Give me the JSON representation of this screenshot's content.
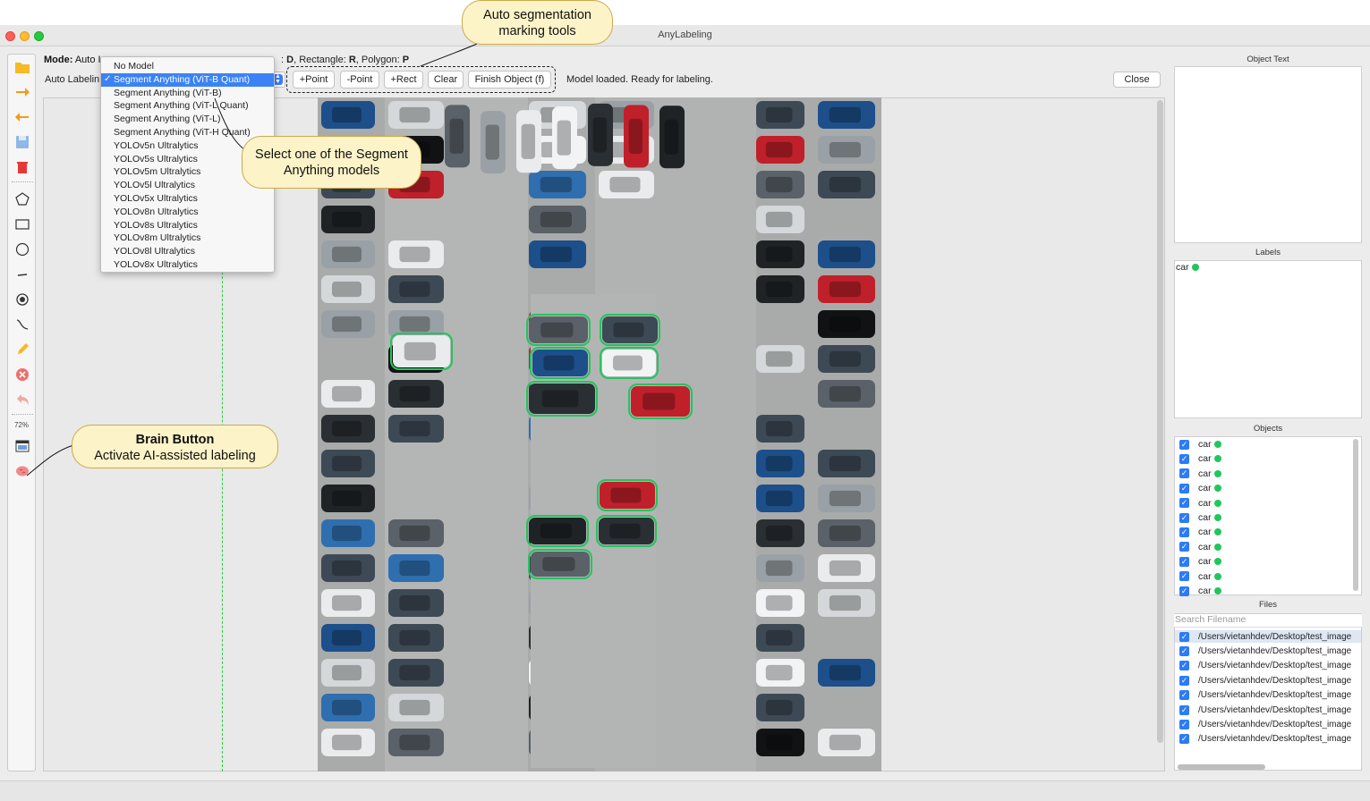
{
  "window": {
    "title": "AnyLabeling"
  },
  "mode": {
    "prefix": "Mode:",
    "value": "Auto I",
    "shortcut_d": "D",
    "rect_text": ", Rectangle: ",
    "shortcut_r": "R",
    "poly_text": ", Polygon: ",
    "shortcut_p": "P",
    "lead": ": "
  },
  "auto_labeling": {
    "label": "Auto Labelin"
  },
  "model_dropdown": {
    "items": [
      {
        "label": "No Model"
      },
      {
        "label": "Segment Anything (ViT-B Quant)",
        "selected": true
      },
      {
        "label": "Segment Anything (ViT-B)"
      },
      {
        "label": "Segment Anything (ViT-L Quant)"
      },
      {
        "label": "Segment Anything (ViT-L)"
      },
      {
        "label": "Segment Anything (ViT-H Quant)"
      },
      {
        "label": "YOLOv5n Ultralytics"
      },
      {
        "label": "YOLOv5s Ultralytics"
      },
      {
        "label": "YOLOv5m Ultralytics"
      },
      {
        "label": "YOLOv5l Ultralytics"
      },
      {
        "label": "YOLOv5x Ultralytics"
      },
      {
        "label": "YOLOv8n Ultralytics"
      },
      {
        "label": "YOLOv8s Ultralytics"
      },
      {
        "label": "YOLOv8m Ultralytics"
      },
      {
        "label": "YOLOv8l Ultralytics"
      },
      {
        "label": "YOLOv8x Ultralytics"
      }
    ],
    "check": "✓"
  },
  "seg_buttons": {
    "add_point": "+Point",
    "remove_point": "-Point",
    "add_rect": "+Rect",
    "clear": "Clear",
    "finish": "Finish Object (f)"
  },
  "status": "Model loaded. Ready for labeling.",
  "close_label": "Close",
  "zoom": "72%",
  "panels": {
    "object_text": "Object Text",
    "labels": "Labels",
    "objects": "Objects",
    "files": "Files",
    "search_placeholder": "Search Filename"
  },
  "labels": [
    {
      "name": "car",
      "color": "#22c55e"
    }
  ],
  "objects": [
    "car",
    "car",
    "car",
    "car",
    "car",
    "car",
    "car",
    "car",
    "car",
    "car",
    "car"
  ],
  "files": [
    "/Users/vietanhdev/Desktop/test_image",
    "/Users/vietanhdev/Desktop/test_image",
    "/Users/vietanhdev/Desktop/test_image",
    "/Users/vietanhdev/Desktop/test_image",
    "/Users/vietanhdev/Desktop/test_image",
    "/Users/vietanhdev/Desktop/test_image",
    "/Users/vietanhdev/Desktop/test_image",
    "/Users/vietanhdev/Desktop/test_image"
  ],
  "callouts": {
    "auto_seg_line1": "Auto segmentation",
    "auto_seg_line2": "marking tools",
    "select_line1": "Select one of the Segment",
    "select_line2": "Anything models",
    "brain_title": "Brain Button",
    "brain_sub": "Activate AI-assisted labeling"
  },
  "colors": {
    "accent": "#3b82f6",
    "label_green": "#22c55e",
    "callout_fill": "#fdf3c8",
    "icon_orange": "#f59e0b",
    "icon_red": "#e53935"
  }
}
